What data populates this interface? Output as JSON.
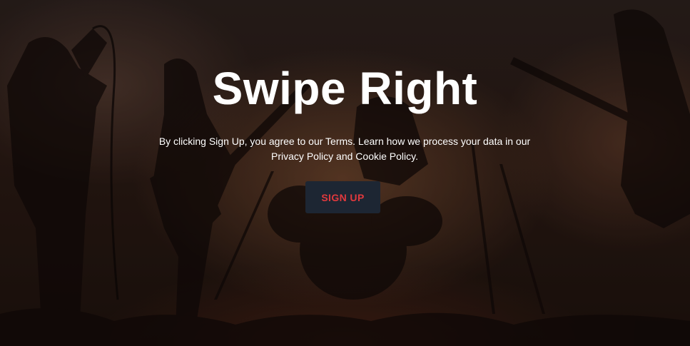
{
  "hero": {
    "title": "Swipe Right",
    "terms_text": "By clicking Sign Up, you agree to our Terms. Learn how we process your data in our Privacy Policy and Cookie Policy.",
    "background_image": "concert-band-stage-photo"
  },
  "signup_button": {
    "label": "SIGN UP"
  },
  "colors": {
    "button_bg": "#1d2633",
    "button_text": "#e0393d",
    "title_text": "#ffffff"
  }
}
